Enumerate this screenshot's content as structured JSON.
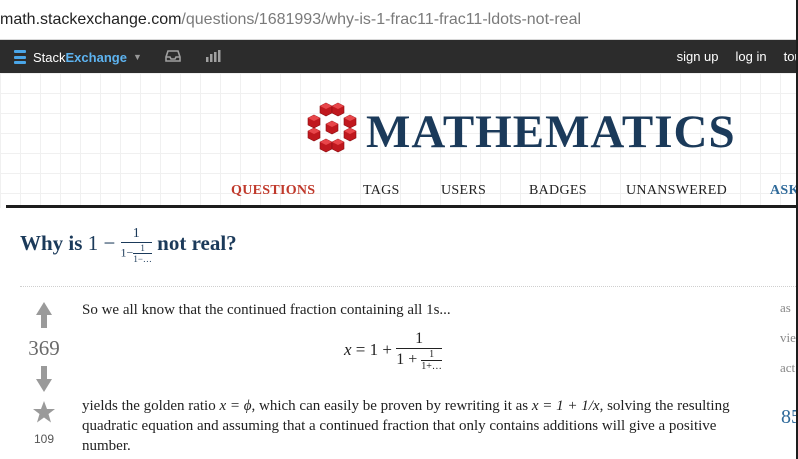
{
  "browser": {
    "url_host": "math.stackexchange.com",
    "url_path": "/questions/1681993/why-is-1-frac11-frac11-ldots-not-real"
  },
  "topbar": {
    "brand_part1": "Stack",
    "brand_part2": "Exchange",
    "caret": "▼",
    "inbox_icon": "inbox-icon",
    "achievements_icon": "achievements-icon",
    "links": [
      "sign up",
      "log in",
      "tour"
    ]
  },
  "site": {
    "title": "MATHEMATICS",
    "logo_color": "#c0181e"
  },
  "nav": {
    "items": [
      "QUESTIONS",
      "TAGS",
      "USERS",
      "BADGES",
      "UNANSWERED",
      "ASK"
    ],
    "active": "QUESTIONS"
  },
  "question": {
    "title_prefix": "Why is",
    "title_one": "1",
    "title_minus": "−",
    "title_num": "1",
    "title_den_prefix": "1−",
    "title_inner_num": "1",
    "title_inner_den": "1−…",
    "title_suffix": "not real?",
    "votes": "369",
    "favorites": "109",
    "paragraph1": "So we all know that the continued fraction containing all 1s...",
    "eq_lhs": "x",
    "eq_mid": "= 1 +",
    "eq_num": "1",
    "eq_den_prefix": "1 +",
    "eq_inner_num": "1",
    "eq_inner_den": "1+…",
    "paragraph2_a": "yields the golden ratio",
    "paragraph2_math1": "x = ϕ",
    "paragraph2_b": ", which can easily be proven by rewriting it as",
    "paragraph2_math2": "x = 1 + 1/x",
    "paragraph2_c": ", solving the resulting quadratic equation and assuming that a continued fraction that only contains additions will give a positive number."
  },
  "sidebar": {
    "labels": [
      "as",
      "vie",
      "act"
    ],
    "number": "85"
  }
}
